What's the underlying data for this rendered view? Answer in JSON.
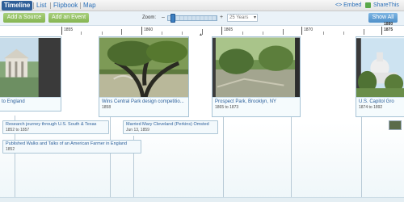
{
  "nav": {
    "tabs": [
      {
        "label": "Timeline",
        "active": true
      },
      {
        "label": "List",
        "active": false
      },
      {
        "label": "Flipbook",
        "active": false
      },
      {
        "label": "Map",
        "active": false
      }
    ],
    "embed_label": "<> Embed",
    "share_label": "ShareThis"
  },
  "toolbar": {
    "add_source_label": "Add a Source",
    "add_event_label": "Add an Event",
    "zoom_label": "Zoom:",
    "zoom_minus": "–",
    "zoom_plus": "+",
    "zoom_value": "25 Years",
    "show_all_label": "Show All"
  },
  "ruler": {
    "years": [
      "1855",
      "1860",
      "1865",
      "1870",
      "1875"
    ],
    "range_start": "1875",
    "range_end": "1880"
  },
  "cards": [
    {
      "title": "to England",
      "date": ""
    },
    {
      "title": "Wins Central Park design competitio...",
      "date": "1858"
    },
    {
      "title": "Prospect Park, Brooklyn, NY",
      "date": "1865 to 1873"
    },
    {
      "title": "U.S. Capitol Gro",
      "date": "1874 to 1892"
    }
  ],
  "events": [
    {
      "title": "Research journey through U.S. South & Texas",
      "date": "1852 to 1857"
    },
    {
      "title": "Married Mary Cleveland (Perkins) Omsted",
      "date": "Jun 13, 1859"
    },
    {
      "title": "Published Walks and Talks of an American Farmer in England",
      "date": "1852"
    }
  ],
  "colors": {
    "accent_blue": "#2f5f98",
    "add_green": "#84b451",
    "link_blue": "#2b5f9a"
  }
}
